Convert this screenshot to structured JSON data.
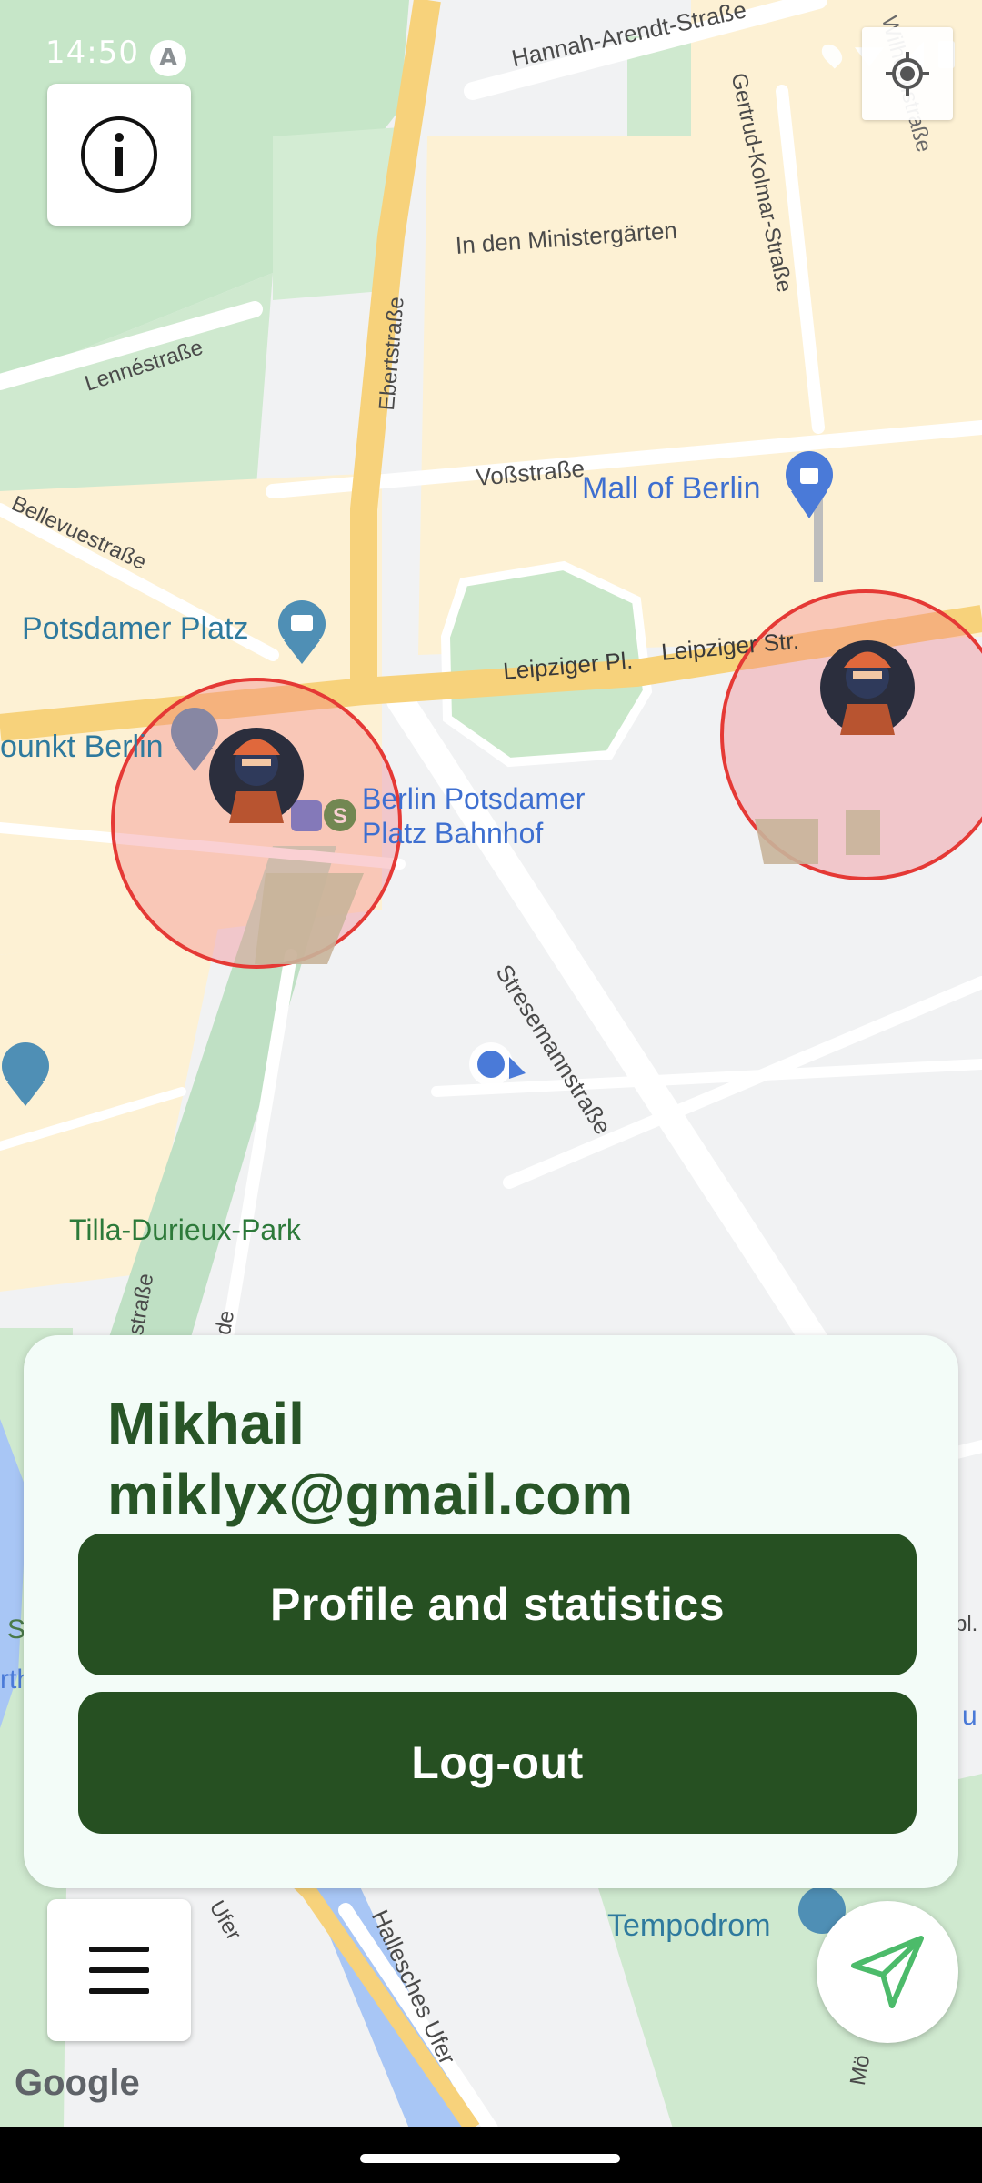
{
  "status_bar": {
    "time": "14:50",
    "badge": "A"
  },
  "map": {
    "streets": {
      "hannah_arendt": "Hannah-Arendt-Straße",
      "wilhelm": "Wilhelmstraße",
      "gertrud_kolmar": "Gertrud-Kolmar-Straße",
      "ministergaerten": "In den Ministergärten",
      "ebert": "Ebertstraße",
      "lenne": "Lennéstraße",
      "voss": "Voßstraße",
      "bellevue": "Bellevuestraße",
      "leipziger_pl": "Leipziger Pl.",
      "leipziger_str": "Leipziger Str.",
      "stresemann": "Stresemannstraße",
      "hallesches_ufer": "Hallesches Ufer",
      "partial_strasse": "straße",
      "partial_de": "de",
      "partial_ufer": "Ufer",
      "partial_moe": "Mö",
      "partial_s": "S",
      "partial_rth": "rth",
      "partial_u": "u",
      "partial_pl": "pl."
    },
    "places": {
      "mall": "Mall of Berlin",
      "potsdamer_platz": "Potsdamer Platz",
      "punkt_berlin": "ounkt Berlin",
      "station": "Berlin Potsdamer\nPlatz Bahnhof",
      "station_line1": "Berlin Potsdamer",
      "station_line2": "Platz Bahnhof",
      "park": "Tilla-Durieux-Park",
      "tempodrom": "Tempodrom"
    },
    "google_logo": "Google",
    "zone_color": "#e53935",
    "zone_fill": "rgba(240,120,130,0.35)"
  },
  "user": {
    "name": "Mikhail",
    "email": "miklyx@gmail.com"
  },
  "actions": {
    "profile_label": "Profile and statistics",
    "logout_label": "Log-out"
  },
  "colors": {
    "accent": "#265022",
    "text_green": "#285527",
    "card_bg": "#f3fcf8",
    "send_icon": "#4cbb6a"
  },
  "icons": {
    "info": "info-icon",
    "menu": "hamburger-menu-icon",
    "locate": "my-location-icon",
    "send": "navigation-arrow-icon"
  }
}
